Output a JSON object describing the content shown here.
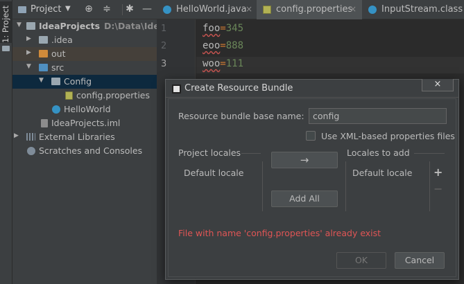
{
  "tool_stripe": {
    "label": "1: Project"
  },
  "project_panel": {
    "title": "Project",
    "tree": [
      {
        "label": "IdeaProjects",
        "hint": "D:\\Data\\IdeaPr",
        "icon": "folder-icon"
      },
      {
        "label": ".idea",
        "icon": "folder-icon"
      },
      {
        "label": "out",
        "icon": "folder-icon"
      },
      {
        "label": "src",
        "icon": "source-folder-icon"
      },
      {
        "label": "Config",
        "icon": "package-icon"
      },
      {
        "label": "config.properties",
        "icon": "properties-file-icon"
      },
      {
        "label": "HelloWorld",
        "icon": "class-icon"
      },
      {
        "label": "IdeaProjects.iml",
        "icon": "module-file-icon"
      },
      {
        "label": "External Libraries",
        "icon": "library-icon"
      },
      {
        "label": "Scratches and Consoles",
        "icon": "scratch-icon"
      }
    ]
  },
  "editor": {
    "tabs": [
      {
        "label": "HelloWorld.java",
        "icon": "class-icon"
      },
      {
        "label": "config.properties",
        "icon": "properties-file-icon"
      },
      {
        "label": "InputStream.class",
        "icon": "class-icon"
      }
    ],
    "line_numbers": [
      "1",
      "2",
      "3"
    ],
    "lines": [
      {
        "key": "foo",
        "eq": "=",
        "value": "345"
      },
      {
        "key": "eoo",
        "eq": "=",
        "value": "888"
      },
      {
        "key": "woo",
        "eq": "=",
        "value": "111"
      }
    ]
  },
  "dialog": {
    "title": "Create Resource Bundle",
    "close_glyph": "×",
    "base_name_label": "Resource bundle base name:",
    "base_name_value": "config",
    "xml_checkbox_label": "Use XML-based properties files",
    "project_locales_label": "Project locales",
    "locales_to_add_label": "Locales to add",
    "project_locales": [
      "Default locale"
    ],
    "locales_to_add": [
      "Default locale"
    ],
    "move_glyph": "→",
    "add_all_label": "Add All",
    "plus_glyph": "+",
    "minus_glyph": "−",
    "error_text": "File with name 'config.properties' already exist",
    "ok_label": "OK",
    "cancel_label": "Cancel"
  }
}
